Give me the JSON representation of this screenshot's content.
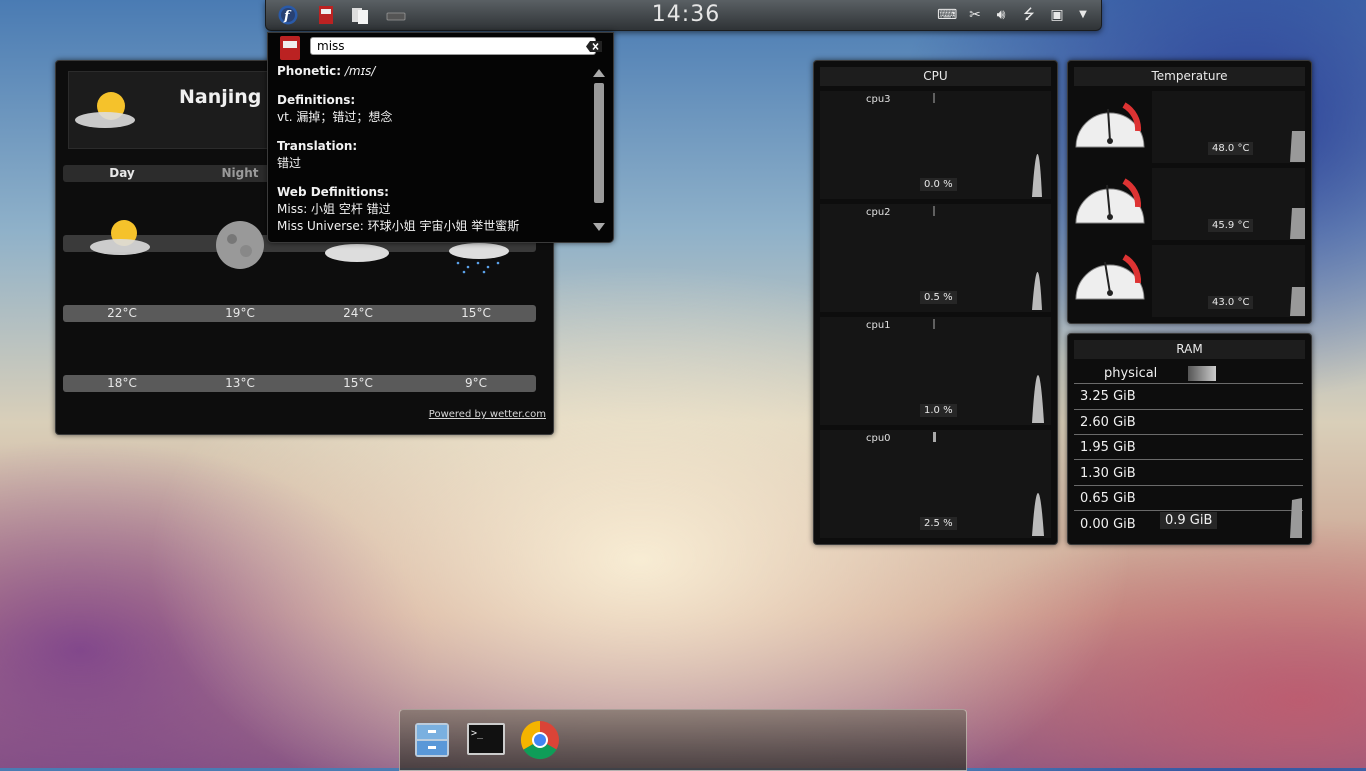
{
  "panel": {
    "clock": "14:36",
    "launchers": [
      "fedora-logo-icon",
      "dictionary-icon",
      "clipboard-icon",
      "keyboard-layout-icon"
    ],
    "tray": [
      "keyboard-icon",
      "scissors-icon",
      "volume-icon",
      "usb-icon",
      "network-icon",
      "dropdown-icon"
    ]
  },
  "weather": {
    "city": "Nanjing",
    "tabs": {
      "day": "Day",
      "night": "Night"
    },
    "high_temps": [
      "22°C",
      "19°C",
      "24°C",
      "15°C"
    ],
    "low_temps": [
      "18°C",
      "13°C",
      "15°C",
      "9°C"
    ],
    "forecast_icons": [
      "partly-sunny-icon",
      "moon-icon",
      "cloudy-icon",
      "rain-icon"
    ],
    "powered_by": "Powered by wetter.com"
  },
  "dictionary": {
    "query": "miss",
    "phonetic_label": "Phonetic:",
    "phonetic_value": "/mɪs/",
    "definitions_label": "Definitions:",
    "definitions_value": "vt. 漏掉；错过；想念",
    "translation_label": "Translation:",
    "translation_value": "错过",
    "web_label": "Web Definitions:",
    "web_1": "Miss: 小姐 空杆 错过",
    "web_2": "Miss Universe: 环球小姐 宇宙小姐 举世蜜斯"
  },
  "cpu": {
    "title": "CPU",
    "cores": [
      {
        "name": "cpu3",
        "value": "0.0 %"
      },
      {
        "name": "cpu2",
        "value": "0.5 %"
      },
      {
        "name": "cpu1",
        "value": "1.0 %"
      },
      {
        "name": "cpu0",
        "value": "2.5 %"
      }
    ]
  },
  "temperature": {
    "title": "Temperature",
    "sensors": [
      "48.0 °C",
      "45.9 °C",
      "43.0 °C"
    ]
  },
  "ram": {
    "title": "RAM",
    "legend": "physical",
    "ticks": [
      "3.25 GiB",
      "2.60 GiB",
      "1.95 GiB",
      "1.30 GiB",
      "0.65 GiB",
      "0.00 GiB"
    ],
    "current": "0.9 GiB"
  },
  "dock": {
    "apps": [
      "file-manager-icon",
      "terminal-icon",
      "chrome-icon"
    ]
  }
}
